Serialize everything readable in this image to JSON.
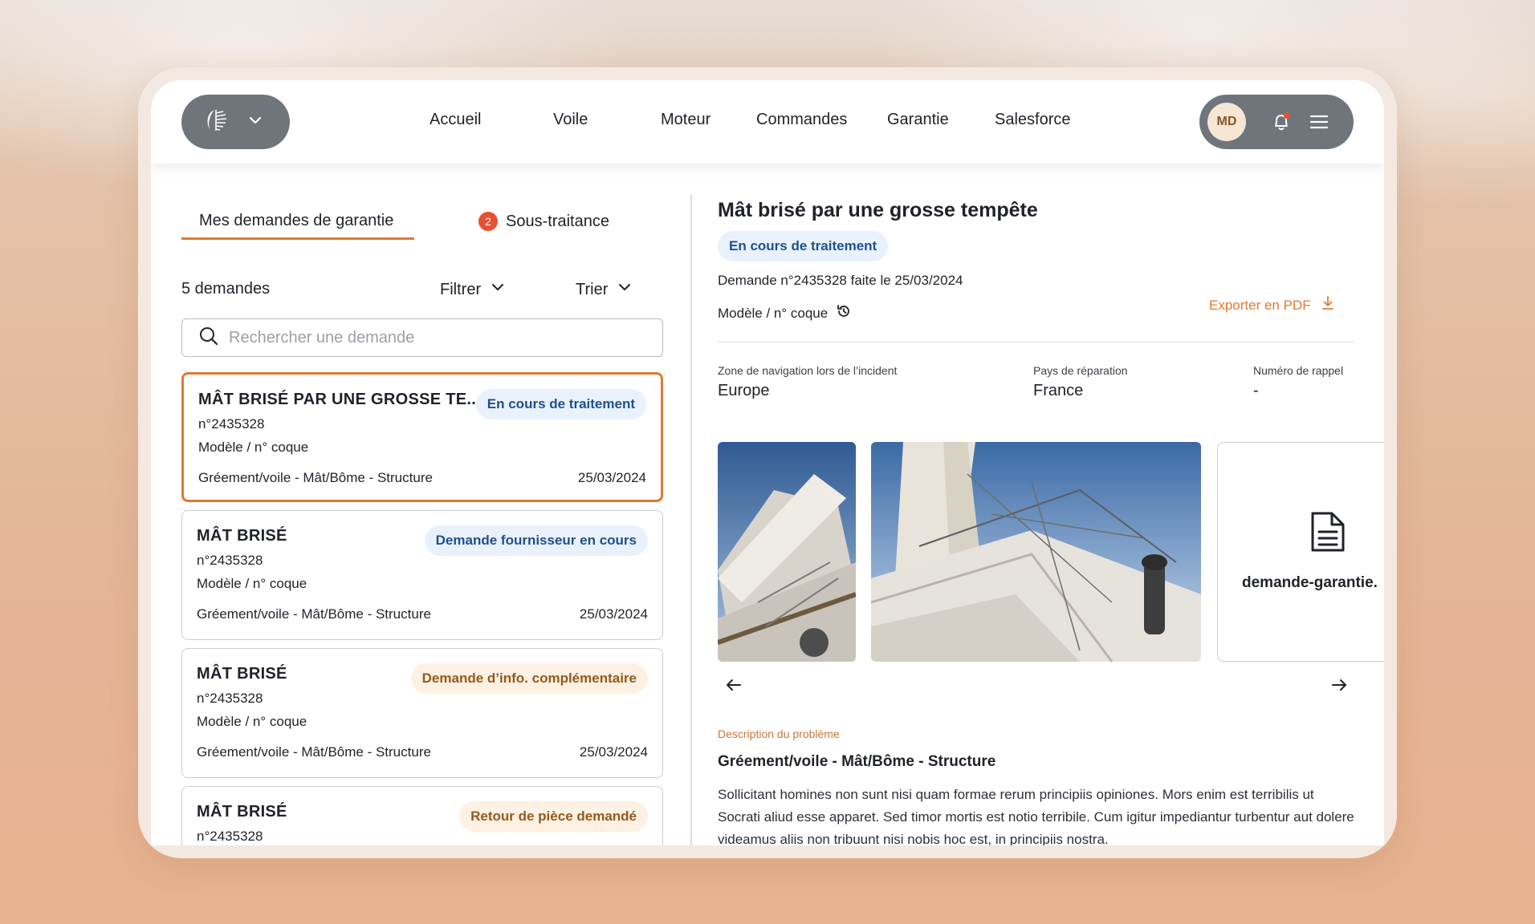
{
  "header": {
    "nav": [
      "Accueil",
      "Voile",
      "Moteur",
      "Commandes",
      "Garantie",
      "Salesforce"
    ],
    "user_initials": "MD"
  },
  "tabs": {
    "active": "Mes demandes de garantie",
    "second": "Sous-traitance",
    "second_count": "2"
  },
  "list": {
    "count_label": "5 demandes",
    "filter_label": "Filtrer",
    "sort_label": "Trier",
    "search_placeholder": "Rechercher une demande",
    "cards": [
      {
        "title": "MÂT BRISÉ PAR UNE GROSSE TE...",
        "number": "n°2435328",
        "model": "Modèle / n° coque",
        "category": "Gréement/voile - Mât/Bôme - Structure",
        "date": "25/03/2024",
        "status": "En cours de traitement",
        "status_color": "#1f4f8c"
      },
      {
        "title": "MÂT BRISÉ",
        "number": "n°2435328",
        "model": "Modèle / n° coque",
        "category": "Gréement/voile - Mât/Bôme - Structure",
        "date": "25/03/2024",
        "status": "Demande fournisseur en cours",
        "status_color": "#1f4f8c"
      },
      {
        "title": "MÂT BRISÉ",
        "number": "n°2435328",
        "model": "Modèle / n° coque",
        "category": "Gréement/voile - Mât/Bôme - Structure",
        "date": "25/03/2024",
        "status": "Demande d’info. complémentaire",
        "status_color": "#915a1d"
      },
      {
        "title": "MÂT BRISÉ",
        "number": "n°2435328",
        "status": "Retour de pièce demandé",
        "status_color": "#915a1d"
      }
    ]
  },
  "detail": {
    "title": "Mât brisé par une grosse tempête",
    "status": "En cours de traitement",
    "request_line": "Demande n°2435328 faite le 25/03/2024",
    "model_label": "Modèle / n° coque",
    "export_label": "Exporter en PDF",
    "fields": [
      {
        "label": "Zone de navigation lors de l’incident",
        "value": "Europe"
      },
      {
        "label": "Pays de réparation",
        "value": "France"
      },
      {
        "label": "Numéro de rappel",
        "value": "-"
      }
    ],
    "attachment_name": "demande-garantie.",
    "description_label": "Description du problème",
    "description_title": "Gréement/voile - Mât/Bôme - Structure",
    "description_text": "Sollicitant homines non sunt nisi quam formae rerum principiis opiniones. Mors enim est terribilis ut Socrati aliud esse apparet. Sed timor mortis est notio terribile. Cum igitur impediantur turbentur aut dolere videamus aliis non tribuunt nisi nobis hoc est, in principiis nostra."
  },
  "colors": {
    "accent": "#e07a32",
    "status_blue_bg": "#e9f2fc",
    "status_peach_bg": "#fdf1e3",
    "notification": "#e84f33"
  }
}
